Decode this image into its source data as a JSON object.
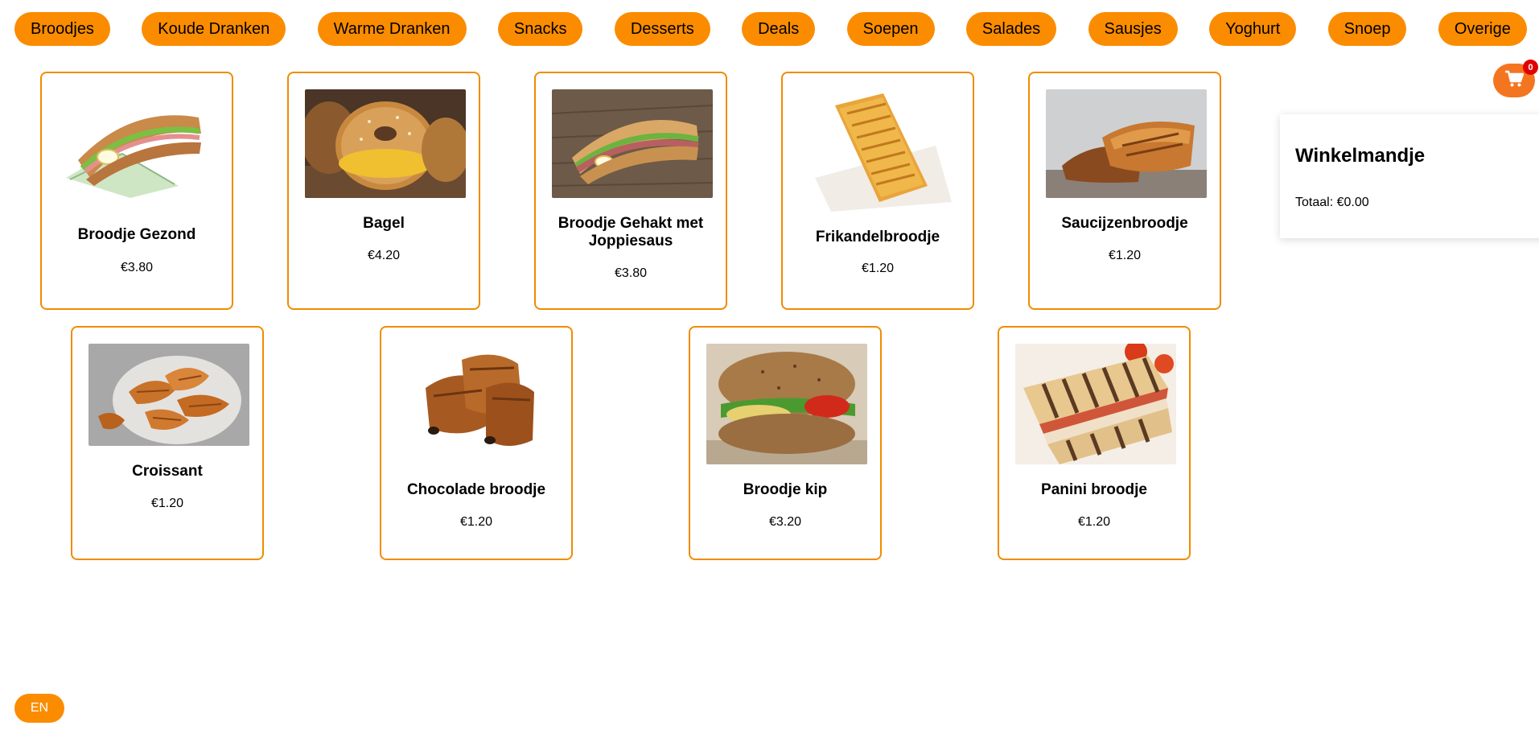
{
  "categories": [
    "Broodjes",
    "Koude Dranken",
    "Warme Dranken",
    "Snacks",
    "Desserts",
    "Deals",
    "Soepen",
    "Salades",
    "Sausjes",
    "Yoghurt",
    "Snoep",
    "Overige"
  ],
  "products": [
    {
      "name": "Broodje Gezond",
      "price": "€3.80",
      "icon": "sandwich-image"
    },
    {
      "name": "Bagel",
      "price": "€4.20",
      "icon": "bagel-image"
    },
    {
      "name": "Broodje Gehakt met Joppiesaus",
      "price": "€3.80",
      "icon": "baguette-image"
    },
    {
      "name": "Frikandelbroodje",
      "price": "€1.20",
      "icon": "pastry-image"
    },
    {
      "name": "Saucijzenbroodje",
      "price": "€1.20",
      "icon": "sausage-roll-image"
    },
    {
      "name": "Croissant",
      "price": "€1.20",
      "icon": "croissant-image"
    },
    {
      "name": "Chocolade broodje",
      "price": "€1.20",
      "icon": "pain-au-chocolat-image"
    },
    {
      "name": "Broodje kip",
      "price": "€3.20",
      "icon": "chicken-sandwich-image"
    },
    {
      "name": "Panini broodje",
      "price": "€1.20",
      "icon": "panini-image"
    }
  ],
  "cart": {
    "title": "Winkelmandje",
    "total": "Totaal: €0.00",
    "count": "0"
  },
  "language": "EN",
  "colors": {
    "accent": "#fb8c00",
    "card_border": "#f08c00",
    "cart_button": "#f4751f",
    "badge": "#e00000"
  }
}
